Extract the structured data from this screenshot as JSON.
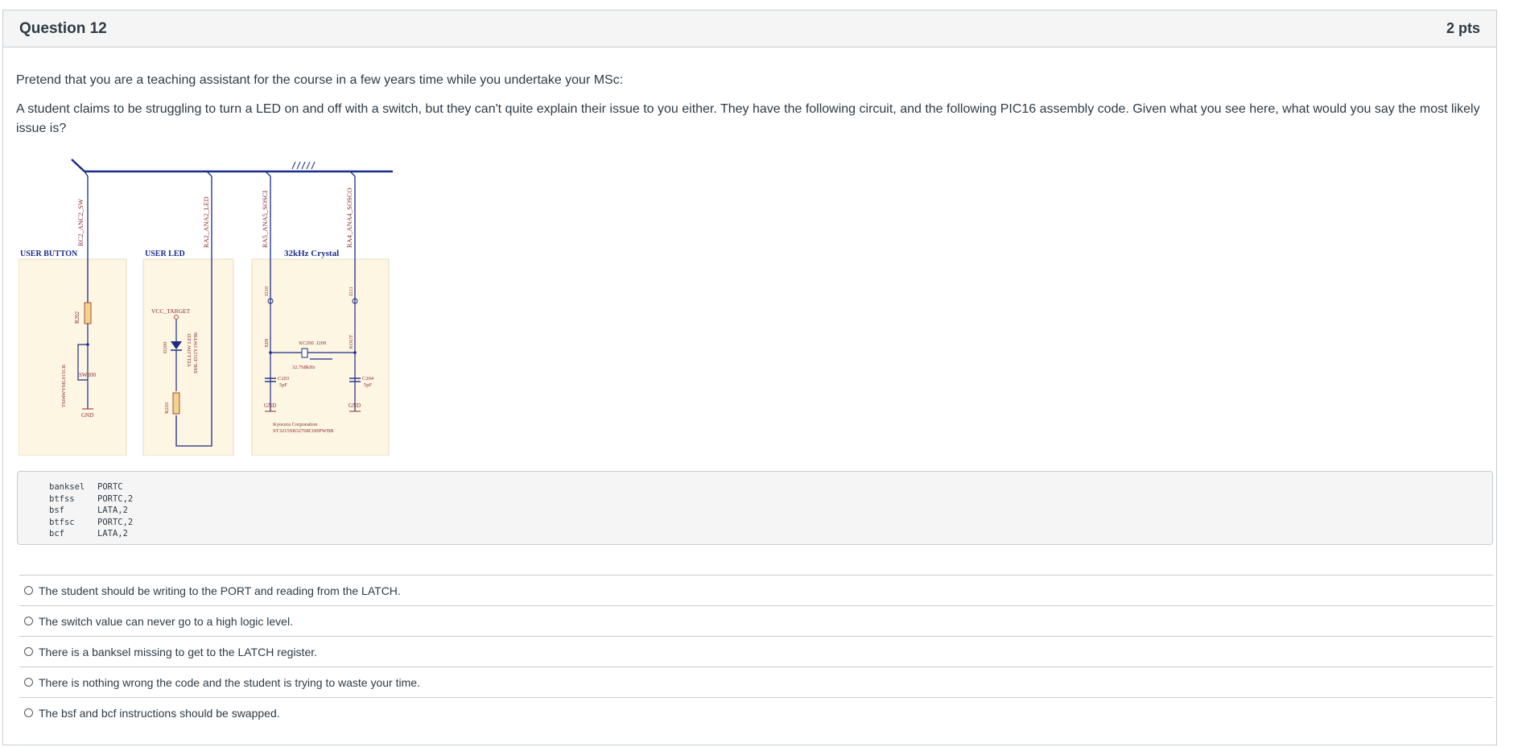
{
  "question": {
    "title": "Question 12",
    "points": "2 pts",
    "prompt_intro": "Pretend that you are a teaching assistant for the course in a few years time while you undertake your MSc:",
    "prompt_body": "A student claims to be struggling to turn a LED on and off with a switch, but they can't quite explain their issue to you either. They have the following circuit, and the following PIC16 assembly code. Given what you see here, what would you say the most likely issue is?"
  },
  "schematic": {
    "sections": [
      "USER BUTTON",
      "USER LED",
      "32kHz Crystal"
    ],
    "net_labels": [
      "RC2_ANC2_SW",
      "RA2_ANA2_LED",
      "RA5_ANA5_SOSCI",
      "RA4_ANA4_SOSCO"
    ],
    "components": {
      "r202": "R202",
      "sw200": "SW200",
      "sw_part": "TS04WYML015CR",
      "gnd": "GND",
      "vcc": "VCC_TARGET",
      "d200": "D200",
      "led_name": "YELLOW LED",
      "led_part": "SML-D12Y1WT86",
      "r203": "R203",
      "j210": "J210",
      "j211": "J211",
      "xin": "XIN",
      "xout": "XOUT",
      "xc200": "XC200",
      "j209": "J209",
      "freq": "32.768kHz",
      "c203": "C203",
      "c204": "C204",
      "cap_val": "5pF",
      "mfr": "Kyocera Corporation",
      "mfr_part": "ST3215SB32768C0HPWBB"
    }
  },
  "code": {
    "lines": [
      {
        "op": "banksel",
        "arg": "PORTC"
      },
      {
        "op": "btfss",
        "arg": "PORTC,2"
      },
      {
        "op": "bsf",
        "arg": "LATA,2"
      },
      {
        "op": "btfsc",
        "arg": "PORTC,2"
      },
      {
        "op": "bcf",
        "arg": "LATA,2"
      }
    ]
  },
  "answers": [
    "The student should be writing to the PORT and reading from the LATCH.",
    "The switch value can never go to a high logic level.",
    "There is a banksel missing to get to the LATCH register.",
    "There is nothing wrong the code and the student is trying to waste your time.",
    "The bsf and bcf instructions should be swapped."
  ],
  "colors": {
    "schematic_wire": "#1c2b8a",
    "schematic_label": "#8a2b2b",
    "section_fill": "#fdf6e3",
    "border": "#c7cdd1",
    "text": "#2d3b45"
  }
}
